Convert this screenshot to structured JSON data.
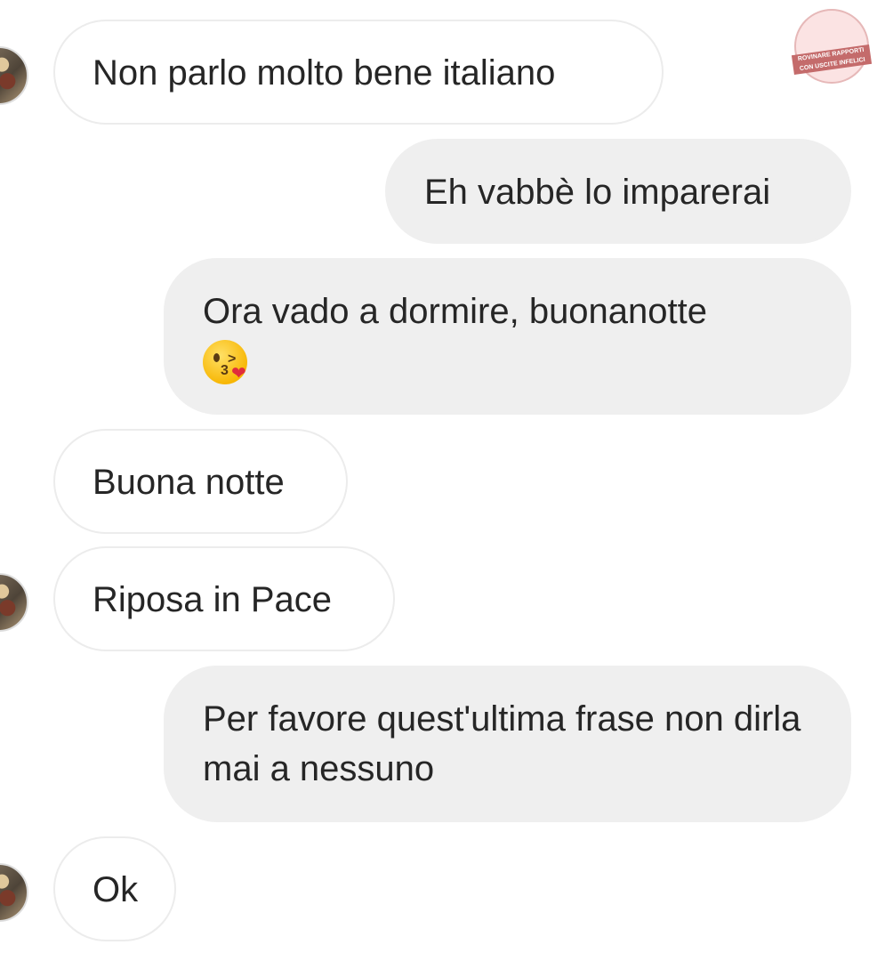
{
  "messages": [
    {
      "from": "other",
      "text": "Non parlo molto bene italiano",
      "avatar": true
    },
    {
      "from": "me",
      "text": "Eh vabbè lo imparerai"
    },
    {
      "from": "me",
      "text": "Ora vado a dormire, buonanotte",
      "emoji": "kissing-face-with-heart-emoji"
    },
    {
      "from": "other",
      "text": "Buona notte",
      "avatar": false
    },
    {
      "from": "other",
      "text": "Riposa in Pace",
      "avatar": true
    },
    {
      "from": "me",
      "text": "Per favore quest'ultima frase non dirla mai a nessuno"
    },
    {
      "from": "other",
      "text": "Ok",
      "avatar": true
    }
  ],
  "watermark": {
    "line1": "ROVINARE RAPPORTI",
    "line2": "CON USCITE INFELICI"
  },
  "colors": {
    "incoming_bubble": "#ffffff",
    "outgoing_bubble": "#efefef",
    "text": "#262626"
  }
}
